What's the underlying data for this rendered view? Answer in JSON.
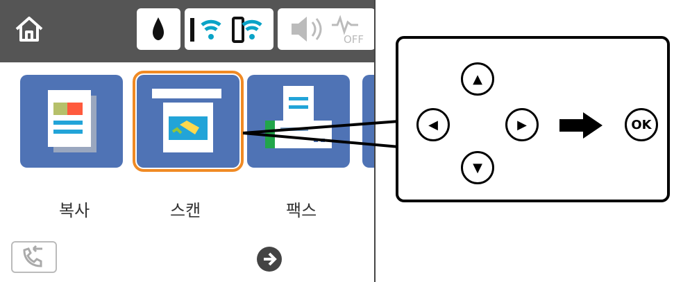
{
  "header": {
    "icons": [
      "home-icon",
      "ink-drop-icon",
      "wifi-icon",
      "wifi-direct-icon",
      "sound-icon",
      "power-saving-off-icon"
    ],
    "power_saving_text": "OFF"
  },
  "tiles": [
    {
      "label": "복사",
      "selected": false
    },
    {
      "label": "스캔",
      "selected": true
    },
    {
      "label": "팩스",
      "selected": false
    }
  ],
  "footer": {
    "left_icon": "fax-history-icon",
    "right_icon": "next-arrow-icon"
  },
  "callout": {
    "ok_label": "OK",
    "buttons": [
      "up-button",
      "left-button",
      "right-button",
      "down-button",
      "ok-button"
    ]
  }
}
